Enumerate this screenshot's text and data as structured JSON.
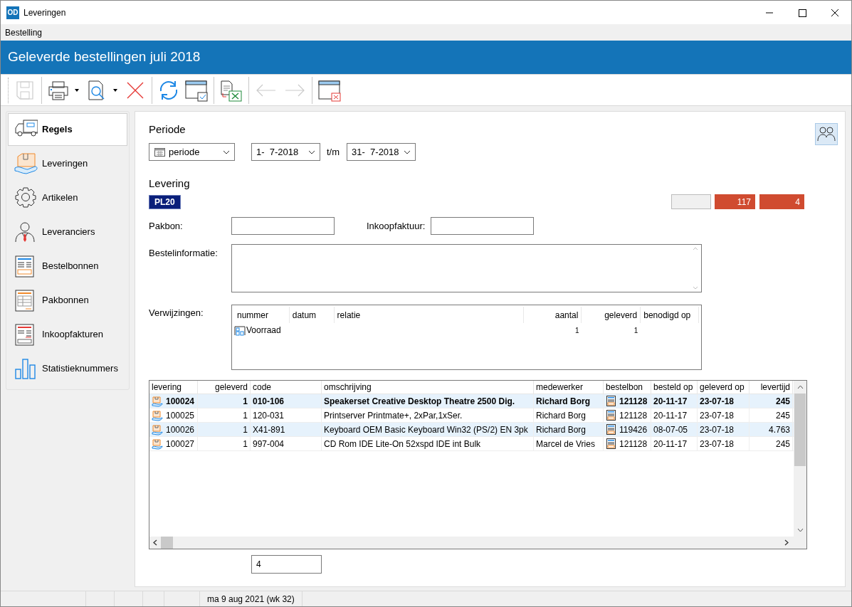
{
  "window": {
    "title": "Leveringen",
    "app_logo": "OD"
  },
  "menu": [
    "Bestelling"
  ],
  "header": {
    "title": "Geleverde bestellingen juli 2018"
  },
  "toolbar": [
    {
      "kind": "save",
      "disabled": true
    },
    {
      "kind": "print",
      "disabled": false
    },
    {
      "kind": "preview",
      "disabled": false
    },
    {
      "kind": "delete",
      "disabled": false
    },
    {
      "kind": "refresh",
      "disabled": false
    },
    {
      "kind": "window-check",
      "disabled": false
    },
    {
      "kind": "export",
      "disabled": false
    },
    {
      "kind": "back",
      "disabled": true
    },
    {
      "kind": "forward",
      "disabled": true
    },
    {
      "kind": "close-window",
      "disabled": false
    }
  ],
  "sidebar": {
    "items": [
      {
        "kind": "truck",
        "label": "Regels",
        "selected": true
      },
      {
        "kind": "package",
        "label": "Leveringen",
        "selected": false
      },
      {
        "kind": "gear",
        "label": "Artikelen",
        "selected": false
      },
      {
        "kind": "person",
        "label": "Leveranciers",
        "selected": false
      },
      {
        "kind": "order",
        "label": "Bestelbonnen",
        "selected": false
      },
      {
        "kind": "packing",
        "label": "Pakbonnen",
        "selected": false
      },
      {
        "kind": "invoice",
        "label": "Inkoopfakturen",
        "selected": false
      },
      {
        "kind": "chart",
        "label": "Statistieknummers",
        "selected": false
      }
    ]
  },
  "period": {
    "label": "Periode",
    "mode": "periode",
    "from": "1-  7-2018",
    "separator": "t/m",
    "to": "31-  7-2018"
  },
  "levering": {
    "label": "Levering",
    "code": "PL20",
    "counters": [
      {
        "text": "117",
        "color": "#d04b30"
      },
      {
        "text": "4",
        "color": "#d04b30"
      }
    ],
    "fields": [
      {
        "label": "Pakbon:"
      },
      {
        "label": "Inkoopfaktuur:"
      }
    ],
    "info_label": "Bestelinformatie:"
  },
  "references": {
    "label": "Verwijzingen:",
    "columns": [
      "nummer",
      "datum",
      "relatie",
      "aantal",
      "geleverd",
      "benodigd op"
    ],
    "rows": [
      {
        "nummer": "Voorraad",
        "aantal": "1",
        "geleverd": "1"
      }
    ]
  },
  "table": {
    "columns": [
      "levering",
      "geleverd",
      "code",
      "omschrijving",
      "medewerker",
      "bestelbon",
      "besteld op",
      "geleverd op",
      "levertijd"
    ],
    "rows": [
      {
        "selected": true,
        "levering": "100024",
        "geleverd": "1",
        "code": "010-106",
        "omschrijving": "Speakerset Creative Desktop Theatre 2500 Dig.",
        "medewerker": "Richard Borg",
        "bestelbon": "121128",
        "besteld_op": "20-11-17",
        "geleverd_op": "23-07-18",
        "levertijd": "245"
      },
      {
        "selected": false,
        "levering": "100025",
        "geleverd": "1",
        "code": "120-031",
        "omschrijving": "Printserver Printmate+, 2xPar,1xSer.",
        "medewerker": "Richard Borg",
        "bestelbon": "121128",
        "besteld_op": "20-11-17",
        "geleverd_op": "23-07-18",
        "levertijd": "245"
      },
      {
        "selected": false,
        "levering": "100026",
        "geleverd": "1",
        "code": "X41-891",
        "omschrijving": "Keyboard OEM Basic Keyboard Win32 (PS/2) EN 3pk",
        "medewerker": "Richard Borg",
        "bestelbon": "119426",
        "besteld_op": "08-07-05",
        "geleverd_op": "23-07-18",
        "levertijd": "4.763"
      },
      {
        "selected": false,
        "levering": "100027",
        "geleverd": "1",
        "code": "997-004",
        "omschrijving": "CD Rom IDE Lite-On 52xspd IDE int Bulk",
        "medewerker": "Marcel de Vries",
        "bestelbon": "121128",
        "besteld_op": "20-11-17",
        "geleverd_op": "23-07-18",
        "levertijd": "245"
      }
    ]
  },
  "total": "4",
  "status_bar": {
    "date": "ma 9 aug 2021 (wk 32)"
  }
}
